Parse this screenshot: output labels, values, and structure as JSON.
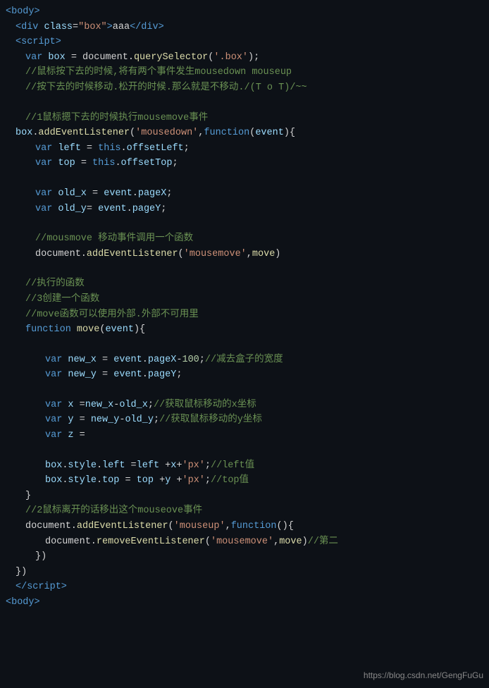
{
  "title": "Code Editor Screenshot",
  "watermark": "https://blog.csdn.net/GengFuGu",
  "lines": [
    {
      "id": 1,
      "content": "body_open"
    },
    {
      "id": 2,
      "content": "div_class_box"
    },
    {
      "id": 3,
      "content": "script_open"
    },
    {
      "id": 4,
      "content": "var_box"
    },
    {
      "id": 5,
      "content": "comment_mousedown_mouseup"
    },
    {
      "id": 6,
      "content": "comment_press_move"
    },
    {
      "id": 7,
      "content": "empty"
    },
    {
      "id": 8,
      "content": "comment_1_mousedown"
    },
    {
      "id": 9,
      "content": "box_addeventlistener_mousedown"
    },
    {
      "id": 10,
      "content": "var_left"
    },
    {
      "id": 11,
      "content": "var_top"
    },
    {
      "id": 12,
      "content": "empty"
    },
    {
      "id": 13,
      "content": "var_old_x"
    },
    {
      "id": 14,
      "content": "var_old_y"
    },
    {
      "id": 15,
      "content": "empty"
    },
    {
      "id": 16,
      "content": "comment_mousemove"
    },
    {
      "id": 17,
      "content": "document_addeventlistener_mousemove"
    },
    {
      "id": 18,
      "content": "empty"
    },
    {
      "id": 19,
      "content": "comment_zhixing"
    },
    {
      "id": 20,
      "content": "comment_3_create"
    },
    {
      "id": 21,
      "content": "comment_move_outside"
    },
    {
      "id": 22,
      "content": "function_move"
    },
    {
      "id": 23,
      "content": "empty"
    },
    {
      "id": 24,
      "content": "var_new_x"
    },
    {
      "id": 25,
      "content": "var_new_y"
    },
    {
      "id": 26,
      "content": "empty"
    },
    {
      "id": 27,
      "content": "var_x"
    },
    {
      "id": 28,
      "content": "var_y"
    },
    {
      "id": 29,
      "content": "var_z"
    },
    {
      "id": 30,
      "content": "empty"
    },
    {
      "id": 31,
      "content": "box_style_left"
    },
    {
      "id": 32,
      "content": "box_style_top"
    },
    {
      "id": 33,
      "content": "close_brace"
    },
    {
      "id": 34,
      "content": "comment_2_mouseout"
    },
    {
      "id": 35,
      "content": "document_addeventlistener_mouseup"
    },
    {
      "id": 36,
      "content": "document_removeeventlistener"
    },
    {
      "id": 37,
      "content": "close_brace_2"
    },
    {
      "id": 38,
      "content": "close_brace_3"
    },
    {
      "id": 39,
      "content": "script_close"
    },
    {
      "id": 40,
      "content": "body_close"
    }
  ]
}
